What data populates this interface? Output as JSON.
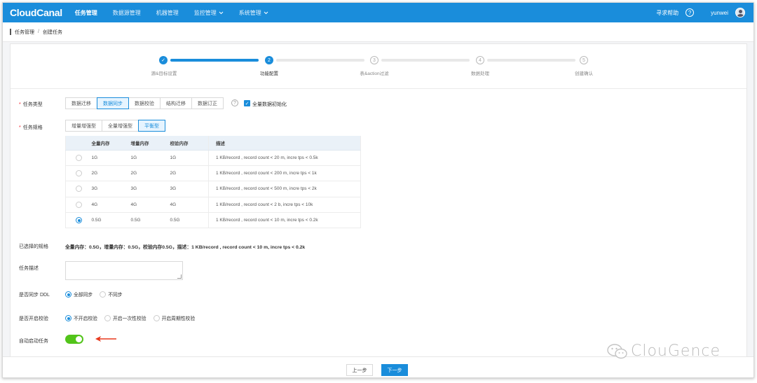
{
  "app": {
    "logo": "CloudCanal"
  },
  "nav": {
    "items": [
      {
        "label": "任务管理",
        "active": true,
        "dropdown": false
      },
      {
        "label": "数据源管理",
        "active": false,
        "dropdown": false
      },
      {
        "label": "机器管理",
        "active": false,
        "dropdown": false
      },
      {
        "label": "监控管理",
        "active": false,
        "dropdown": true
      },
      {
        "label": "系统管理",
        "active": false,
        "dropdown": true
      }
    ],
    "help": "寻求帮助",
    "help_icon": "?",
    "user": "yunwei"
  },
  "breadcrumb": {
    "parent": "任务管理",
    "separator": "/",
    "current": "创建任务"
  },
  "steps": [
    {
      "number": "✓",
      "label": "源&目标设置",
      "state": "done"
    },
    {
      "number": "2",
      "label": "功能配置",
      "state": "active"
    },
    {
      "number": "3",
      "label": "表&action过滤",
      "state": "todo"
    },
    {
      "number": "4",
      "label": "数据处理",
      "state": "todo"
    },
    {
      "number": "5",
      "label": "创建确认",
      "state": "todo"
    }
  ],
  "task_type": {
    "label": "任务类型",
    "options": [
      "数据迁移",
      "数据同步",
      "数据校验",
      "结构迁移",
      "数据订正"
    ],
    "selected": 1,
    "help_icon": "?",
    "full_init_label": "全量数据初始化",
    "full_init_checked": true
  },
  "task_spec": {
    "label": "任务规格",
    "options": [
      "增量增强型",
      "全量增强型",
      "平衡型"
    ],
    "selected": 2
  },
  "spec_table": {
    "headers": [
      "",
      "全量内存",
      "增量内存",
      "校验内存",
      "描述"
    ],
    "rows": [
      {
        "full": "1G",
        "incr": "1G",
        "check": "1G",
        "desc": "1 KB/record , record count < 20 m, incre tps < 0.5k",
        "selected": false
      },
      {
        "full": "2G",
        "incr": "2G",
        "check": "2G",
        "desc": "1 KB/record , record count < 200 m, incre tps < 1k",
        "selected": false
      },
      {
        "full": "3G",
        "incr": "3G",
        "check": "3G",
        "desc": "1 KB/record , record count < 500 m, incre tps < 2k",
        "selected": false
      },
      {
        "full": "4G",
        "incr": "4G",
        "check": "4G",
        "desc": "1 KB/record , record count < 2 b, incre tps < 10k",
        "selected": false
      },
      {
        "full": "0.5G",
        "incr": "0.5G",
        "check": "0.5G",
        "desc": "1 KB/record , record count < 10 m, incre tps < 0.2k",
        "selected": true
      }
    ]
  },
  "selected_spec": {
    "label": "已选择的规格",
    "value": "全量内存：0.5G，增量内存：0.5G，校验内存0.5G，描述：1 KB/record , record count < 10 m, incre tps < 0.2k"
  },
  "task_desc": {
    "label": "任务描述",
    "value": ""
  },
  "sync_ddl": {
    "label": "是否同步 DDL",
    "options": [
      "全部同步",
      "不同步"
    ],
    "selected": 0
  },
  "enable_check": {
    "label": "是否开启校验",
    "options": [
      "不开启校验",
      "开启一次性校验",
      "开启周期性校验"
    ],
    "selected": 0
  },
  "auto_start": {
    "label": "自动启动任务",
    "enabled": true
  },
  "footer": {
    "prev": "上一步",
    "next": "下一步"
  },
  "watermark": {
    "text": "ClouGence"
  },
  "colors": {
    "primary": "#1a8ddb",
    "toggle_on": "#52c41a",
    "required": "#f5222d",
    "arrow": "#e8381d"
  }
}
